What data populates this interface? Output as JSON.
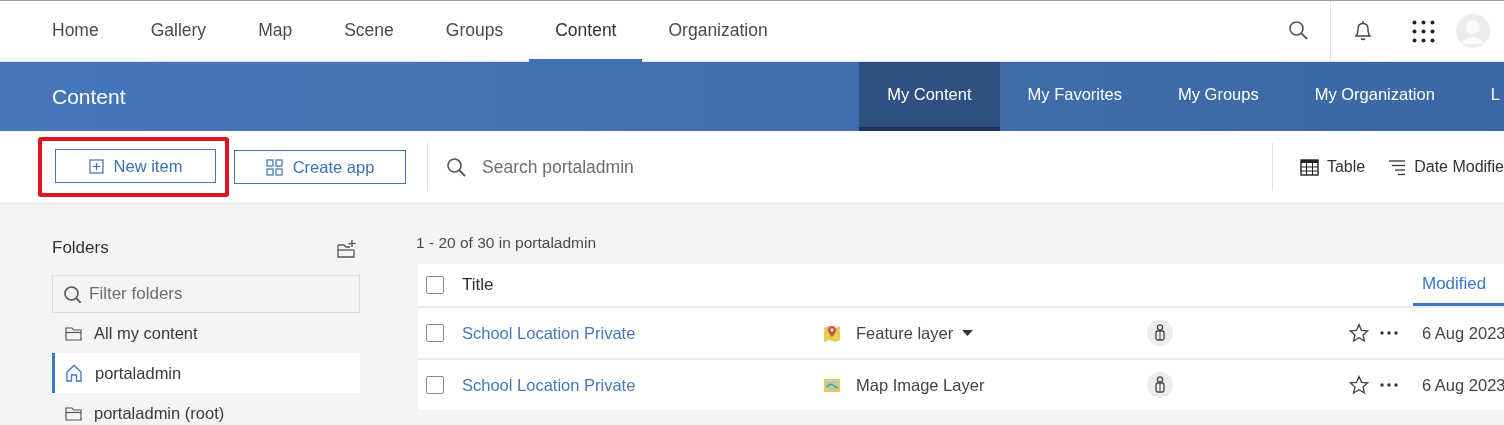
{
  "nav": {
    "items": [
      {
        "label": "Home",
        "selected": false
      },
      {
        "label": "Gallery",
        "selected": false
      },
      {
        "label": "Map",
        "selected": false
      },
      {
        "label": "Scene",
        "selected": false
      },
      {
        "label": "Groups",
        "selected": false
      },
      {
        "label": "Content",
        "selected": true
      },
      {
        "label": "Organization",
        "selected": false
      }
    ]
  },
  "band": {
    "title": "Content",
    "tabs": [
      {
        "label": "My Content",
        "selected": true
      },
      {
        "label": "My Favorites",
        "selected": false
      },
      {
        "label": "My Groups",
        "selected": false
      },
      {
        "label": "My Organization",
        "selected": false
      },
      {
        "label": "L",
        "selected": false
      }
    ]
  },
  "toolbar": {
    "buttons": [
      {
        "label": "New item",
        "kind": "plus",
        "highlighted": true
      },
      {
        "label": "Create app",
        "kind": "grid",
        "highlighted": false
      }
    ],
    "search": {
      "placeholder": "Search portaladmin"
    },
    "view": "Table",
    "sort": "Date Modifie"
  },
  "folders": {
    "title": "Folders",
    "filter": {
      "placeholder": "Filter folders"
    },
    "items": [
      {
        "label": "All my content",
        "kind": "folder",
        "selected": false
      },
      {
        "label": "portaladmin",
        "kind": "home",
        "selected": true
      },
      {
        "label": "portaladmin (root)",
        "kind": "folder",
        "selected": false
      }
    ]
  },
  "results": {
    "summary": "1 - 20 of 30 in portaladmin",
    "table": {
      "select_all_checked": false,
      "columns": [
        {
          "label": "Title",
          "sorted": false
        },
        {
          "label": "Modified",
          "sorted": true
        }
      ],
      "rows": [
        {
          "checked": false,
          "title": "School Location Private",
          "type": "Feature layer",
          "kind": "feature",
          "has_dropdown": true,
          "favorite": false,
          "modified": "6 Aug 2023"
        },
        {
          "checked": false,
          "title": "School Location Private",
          "type": "Map Image Layer",
          "kind": "map-image",
          "has_dropdown": false,
          "favorite": false,
          "modified": "6 Aug 2023"
        }
      ]
    }
  }
}
